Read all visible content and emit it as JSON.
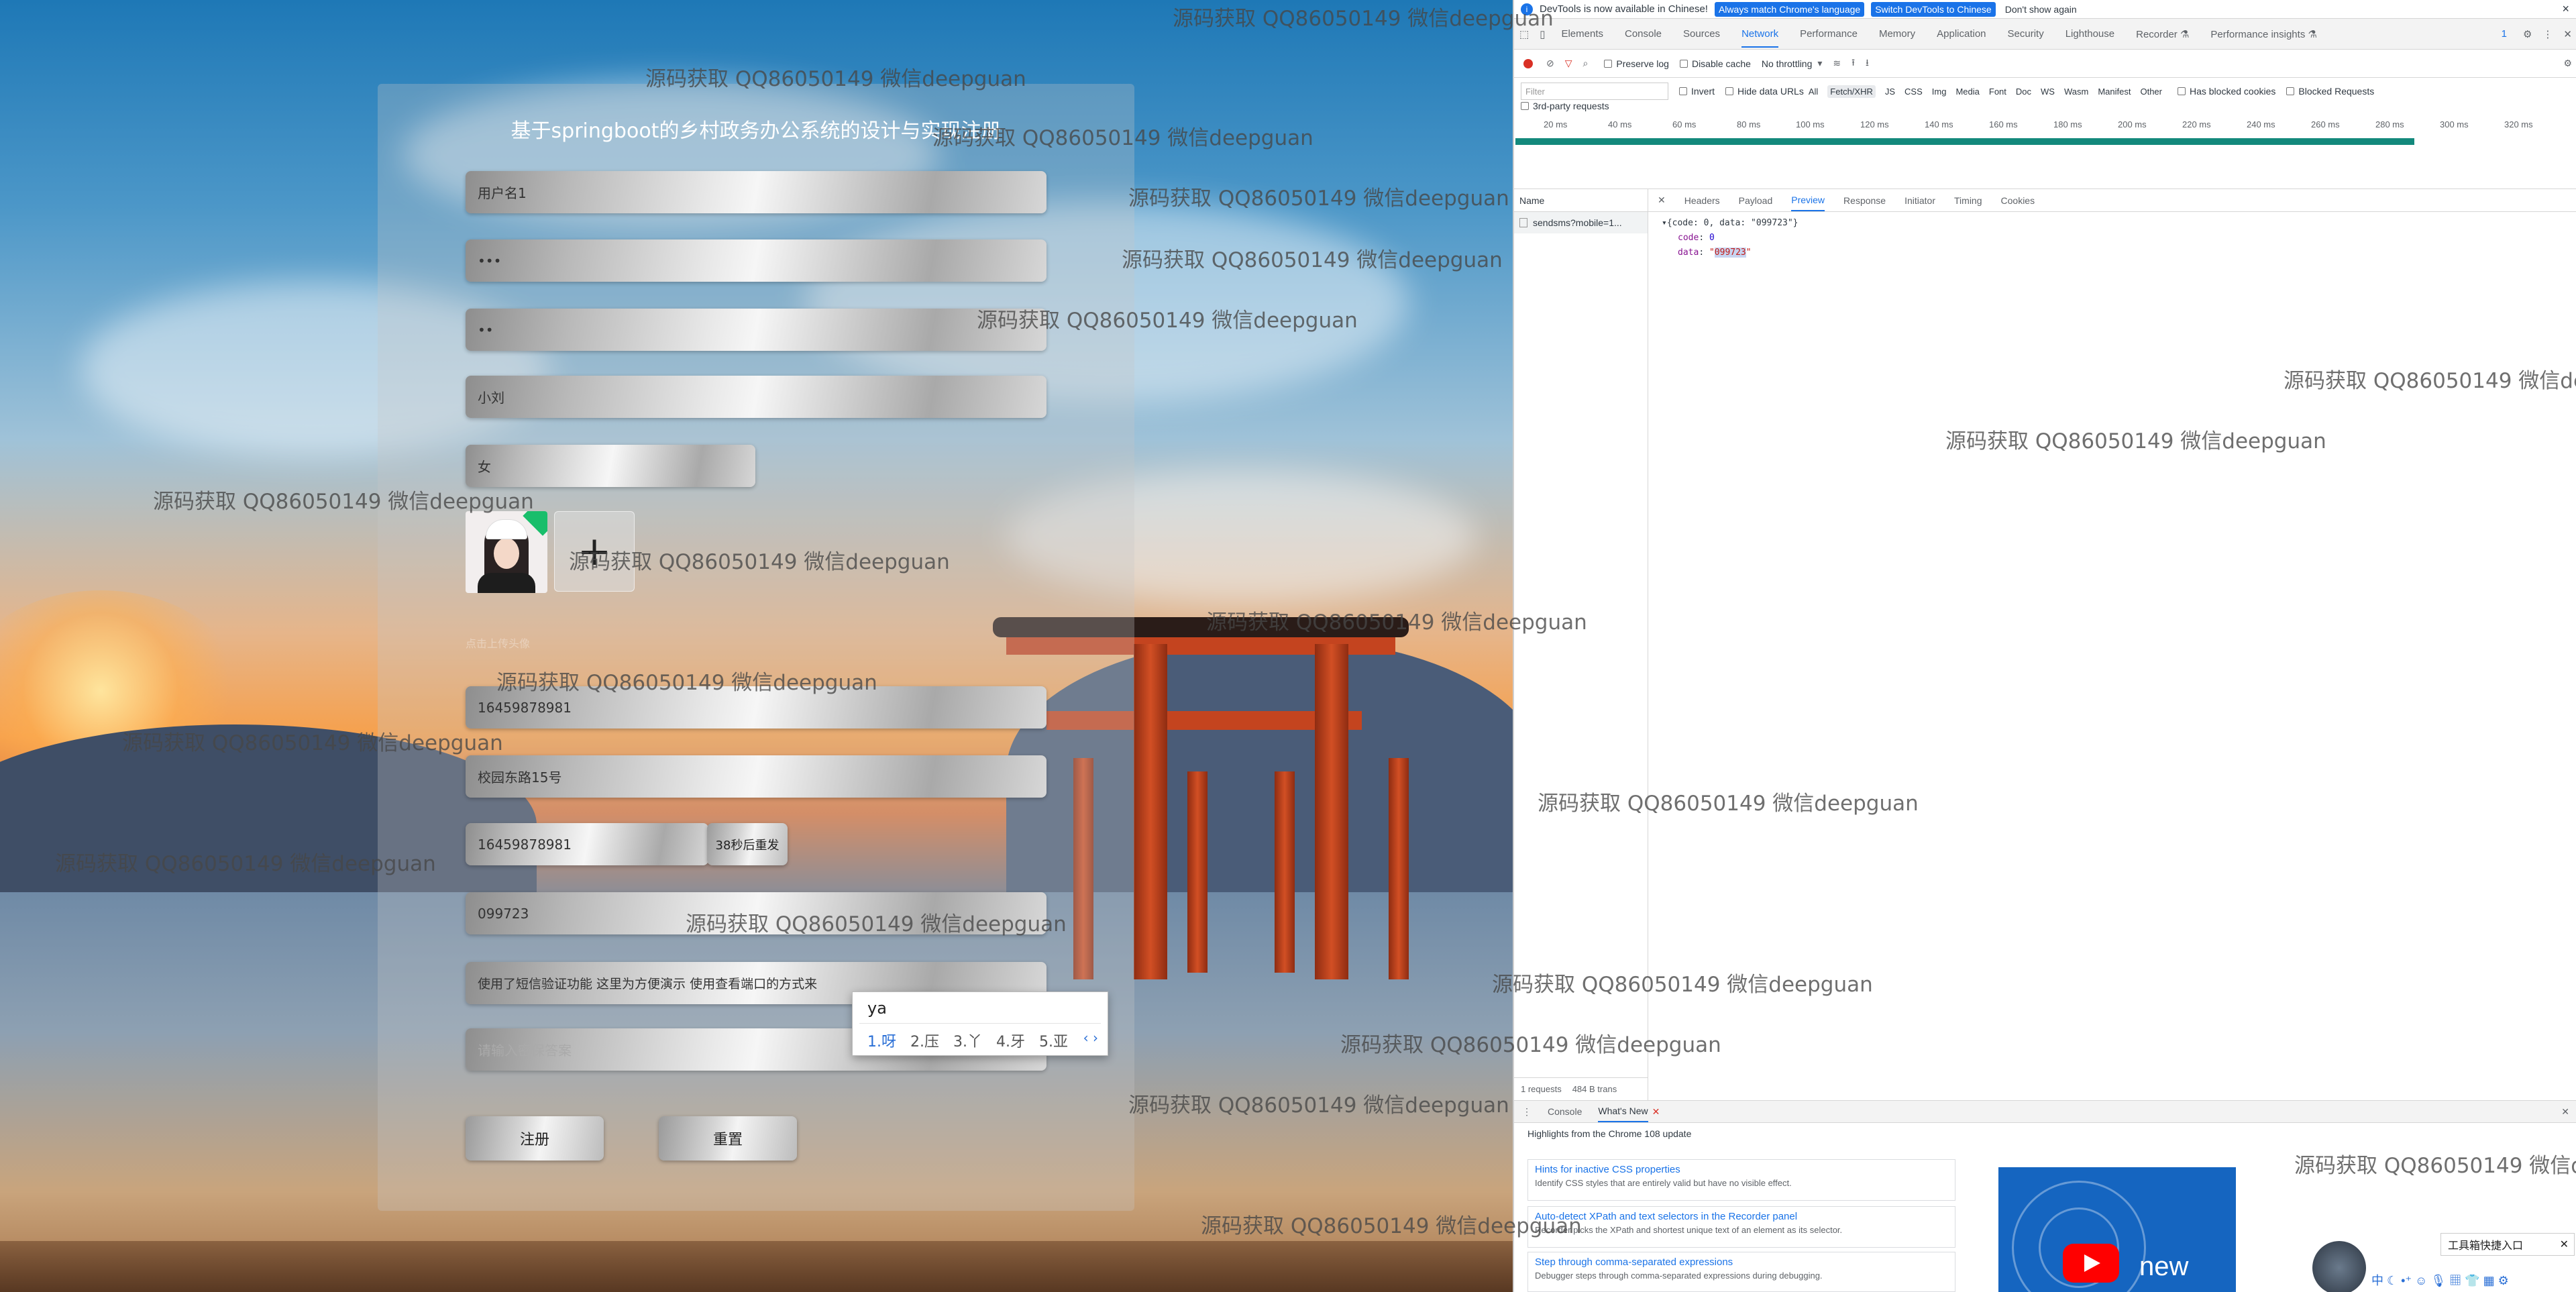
{
  "form": {
    "title": "基于springboot的乡村政务办公系统的设计与实现注册",
    "fields": {
      "username": "用户名1",
      "password": "•••",
      "confirm_password": "••",
      "name": "小刘",
      "gender": "女",
      "hint": "点击上传头像",
      "phone": "16459878981",
      "address": "校园东路15号",
      "sms_phone": "16459878981",
      "sms_countdown": "38秒后重发",
      "sms_code": "099723",
      "note": "使用了短信验证功能 这里为方便演示 使用查看端口的方式来",
      "last_placeholder": "请输入密保答案"
    },
    "buttons": {
      "register": "注册",
      "reset": "重置"
    },
    "avatar_add_symbol": "+"
  },
  "ime": {
    "input": "ya",
    "candidates": [
      "1.呀",
      "2.压",
      "3.丫",
      "4.牙",
      "5.亚"
    ],
    "arrows": "‹ ›"
  },
  "devtools": {
    "infobar": {
      "message": "DevTools is now available in Chinese!",
      "btn_match": "Always match Chrome's language",
      "btn_switch": "Switch DevTools to Chinese",
      "dismiss": "Don't show again",
      "close": "×"
    },
    "tabs": [
      "Elements",
      "Console",
      "Sources",
      "Network",
      "Performance",
      "Memory",
      "Application",
      "Security",
      "Lighthouse",
      "Recorder ⚗",
      "Performance insights ⚗"
    ],
    "issues_count": "1",
    "toolbar": {
      "preserve_log": "Preserve log",
      "disable_cache": "Disable cache",
      "throttling": "No throttling"
    },
    "filter_placeholder": "Filter",
    "filter_options": {
      "invert": "Invert",
      "hide_data_urls": "Hide data URLs",
      "all": "All"
    },
    "filter_types": [
      "Fetch/XHR",
      "JS",
      "CSS",
      "Img",
      "Media",
      "Font",
      "Doc",
      "WS",
      "Wasm",
      "Manifest",
      "Other"
    ],
    "blocked": {
      "cookies": "Has blocked cookies",
      "requests": "Blocked Requests"
    },
    "third_party": "3rd-party requests",
    "timeline_ticks": [
      "20 ms",
      "40 ms",
      "60 ms",
      "80 ms",
      "100 ms",
      "120 ms",
      "140 ms",
      "160 ms",
      "180 ms",
      "200 ms",
      "220 ms",
      "240 ms",
      "260 ms",
      "280 ms",
      "300 ms",
      "320 ms"
    ],
    "name_header": "Name",
    "request_name": "sendsms?mobile=1...",
    "detail_tabs": [
      "Headers",
      "Payload",
      "Preview",
      "Response",
      "Initiator",
      "Timing",
      "Cookies"
    ],
    "preview": {
      "summary": "{code: 0, data: \"099723\"}",
      "code_key": "code",
      "code_val": "0",
      "data_key": "data",
      "data_val": "099723"
    },
    "status": {
      "requests": "1 requests",
      "transferred": "484 B trans"
    },
    "drawer_tabs": [
      "Console",
      "What's New"
    ],
    "whatsnew": {
      "subtitle": "Highlights from the Chrome 108 update",
      "cards": [
        {
          "title": "Hints for inactive CSS properties",
          "desc": "Identify CSS styles that are entirely valid but have no visible effect."
        },
        {
          "title": "Auto-detect XPath and text selectors in the Recorder panel",
          "desc": "Recorder picks the XPath and shortest unique text of an element as its selector."
        },
        {
          "title": "Step through comma-separated expressions",
          "desc": "Debugger steps through comma-separated expressions during debugging."
        }
      ],
      "video_text": "new"
    },
    "tool_entry": "工具箱快捷入口",
    "ime_bar": "中 ☾ •⁺ ☺ 🎙 ▦ 👕 ▦ ⚙"
  },
  "watermark": "源码获取 QQ86050149 微信deepguan"
}
